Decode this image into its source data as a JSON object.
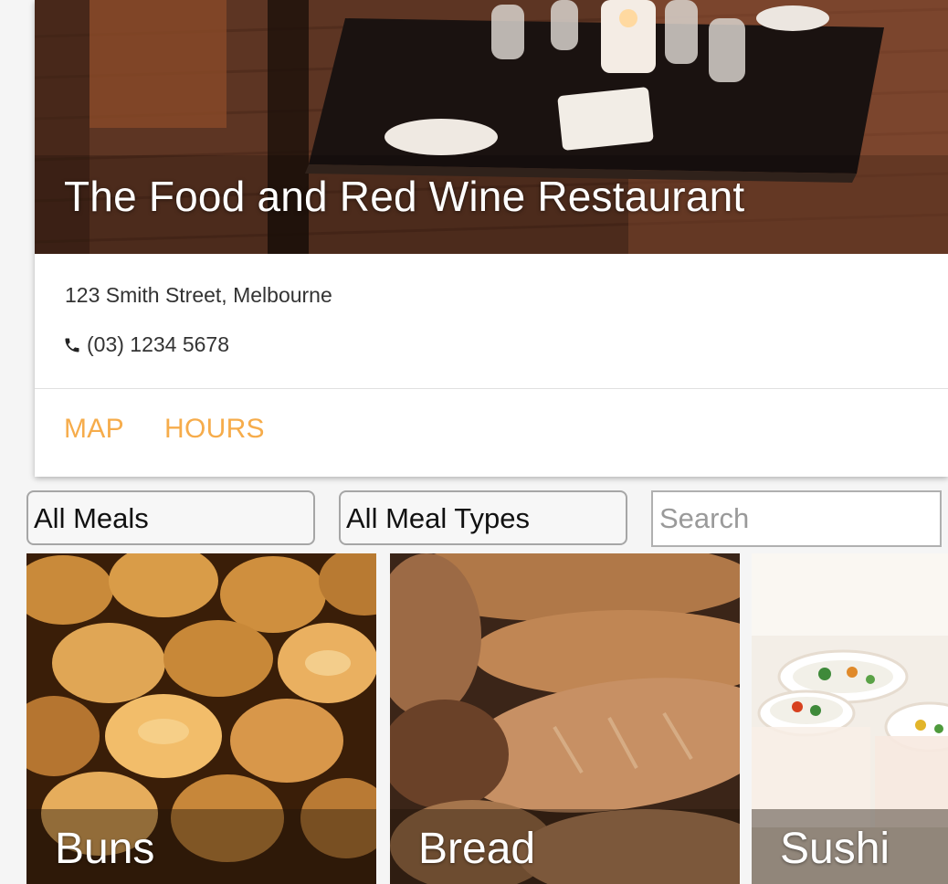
{
  "restaurant": {
    "name": "The Food and Red Wine Restaurant",
    "address": "123 Smith Street, Melbourne",
    "phone": "(03) 1234 5678",
    "actions": {
      "map": "MAP",
      "hours": "HOURS"
    },
    "accent_color": "#f6ac4b"
  },
  "filters": {
    "meals_selected": "All Meals",
    "meal_types_selected": "All Meal Types",
    "search_placeholder": "Search",
    "search_value": ""
  },
  "menu_items": [
    {
      "label": "Buns"
    },
    {
      "label": "Bread"
    },
    {
      "label": "Sushi"
    }
  ],
  "icons": {
    "phone": "phone-icon"
  }
}
